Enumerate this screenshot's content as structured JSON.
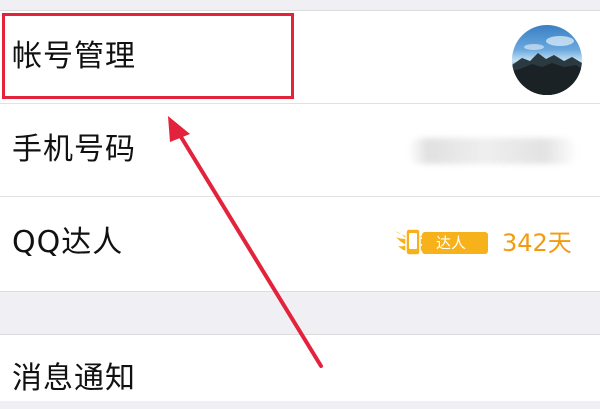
{
  "settings": {
    "rows": [
      {
        "label": "帐号管理",
        "accessory": "avatar"
      },
      {
        "label": "手机号码",
        "accessory": "blurred-phone-number"
      },
      {
        "label": "QQ达人",
        "badge_text": "达人",
        "days": "342天",
        "badge_icon": "winged-phone-icon"
      }
    ],
    "section2": [
      {
        "label": "消息通知"
      }
    ]
  },
  "annotation": {
    "highlight_target": "帐号管理",
    "highlight_color": "#e3223b",
    "arrow_color": "#e3223b"
  },
  "colors": {
    "background": "#efeff4",
    "accent_orange": "#f39b0e",
    "badge_bg": "#f7b21b"
  }
}
